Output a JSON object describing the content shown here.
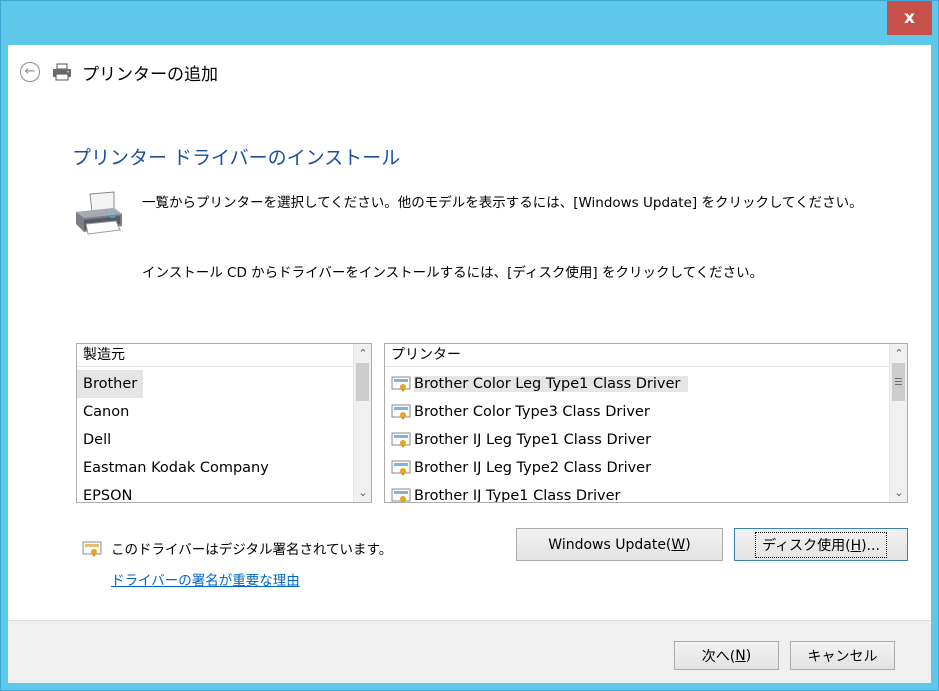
{
  "window": {
    "close_label": "x",
    "title": "プリンターの追加"
  },
  "page": {
    "heading": "プリンター ドライバーのインストール",
    "description_1": "一覧からプリンターを選択してください。他のモデルを表示するには、[Windows Update] をクリックしてください。",
    "description_2": "インストール CD からドライバーをインストールするには、[ディスク使用] をクリックしてください。"
  },
  "manufacturers": {
    "header": "製造元",
    "items": [
      "Brother",
      "Canon",
      "Dell",
      "Eastman Kodak Company",
      "EPSON"
    ],
    "selected": "Brother"
  },
  "printers": {
    "header": "プリンター",
    "items": [
      "Brother Color Leg Type1 Class Driver",
      "Brother Color Type3 Class Driver",
      "Brother IJ Leg Type1 Class Driver",
      "Brother IJ Leg Type2 Class Driver",
      "Brother IJ Type1 Class Driver"
    ],
    "selected": "Brother Color Leg Type1 Class Driver"
  },
  "signature": {
    "text": "このドライバーはデジタル署名されています。",
    "link": "ドライバーの署名が重要な理由"
  },
  "buttons": {
    "windows_update": "Windows Update(",
    "windows_update_key": "W",
    "windows_update_end": ")",
    "have_disk": "ディスク使用(",
    "have_disk_key": "H",
    "have_disk_end": ")...",
    "next": "次へ(",
    "next_key": "N",
    "next_end": ")",
    "cancel": "キャンセル"
  },
  "icons": {
    "back": "back-arrow-icon",
    "printer": "printer-icon",
    "driver": "signed-driver-icon"
  },
  "colors": {
    "title_bar": "#5ec8ea",
    "close_button": "#c7504b",
    "heading": "#1b4f9c",
    "link": "#0066cc"
  }
}
